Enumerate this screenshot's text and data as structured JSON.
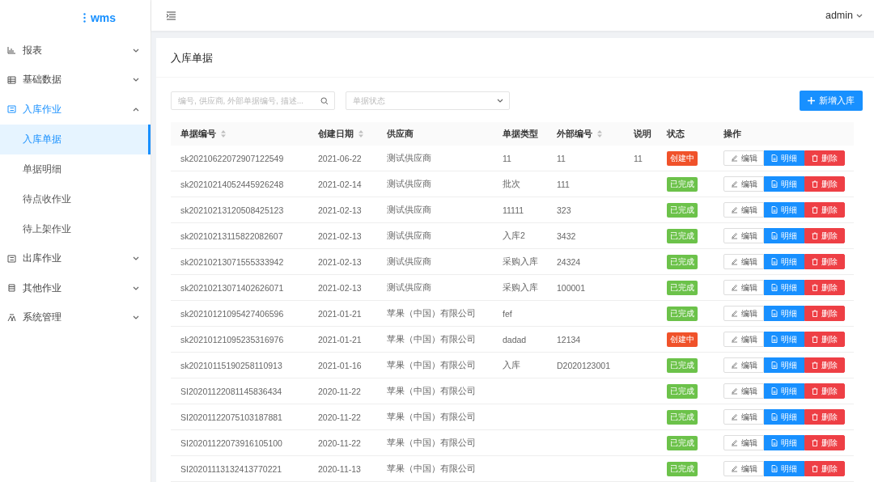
{
  "logo": {
    "text": "wms"
  },
  "header": {
    "user": "admin"
  },
  "sidebar": {
    "items": [
      {
        "label": "报表",
        "expanded": false
      },
      {
        "label": "基础数据",
        "expanded": false
      },
      {
        "label": "入库作业",
        "expanded": true,
        "children": [
          {
            "label": "入库单据",
            "selected": true
          },
          {
            "label": "单据明细",
            "selected": false
          },
          {
            "label": "待点收作业",
            "selected": false
          },
          {
            "label": "待上架作业",
            "selected": false
          }
        ]
      },
      {
        "label": "出库作业",
        "expanded": false
      },
      {
        "label": "其他作业",
        "expanded": false
      },
      {
        "label": "系统管理",
        "expanded": false
      }
    ]
  },
  "page": {
    "title": "入库单据",
    "search": {
      "placeholder": "编号, 供应商, 外部单据编号, 描述..."
    },
    "status_filter": {
      "placeholder": "单据状态"
    },
    "add_button": "新增入库"
  },
  "table": {
    "columns": [
      {
        "label": "单据编号",
        "sortable": true
      },
      {
        "label": "创建日期",
        "sortable": true
      },
      {
        "label": "供应商",
        "sortable": false
      },
      {
        "label": "单据类型",
        "sortable": false
      },
      {
        "label": "外部编号",
        "sortable": true
      },
      {
        "label": "说明",
        "sortable": false
      },
      {
        "label": "状态",
        "sortable": false
      },
      {
        "label": "操作",
        "sortable": false
      }
    ],
    "rows": [
      {
        "id": "sk20210622072907122549",
        "date": "2021-06-22",
        "supplier": "测试供应商",
        "type": "11",
        "external": "11",
        "note": "11",
        "status": {
          "label": "创建中",
          "kind": "creating"
        },
        "actions": [
          "编辑",
          "明细",
          "删除"
        ]
      },
      {
        "id": "sk20210214052445926248",
        "date": "2021-02-14",
        "supplier": "测试供应商",
        "type": "批次",
        "external": "111",
        "status": {
          "label": "已完成",
          "kind": "done"
        },
        "actions": [
          "编辑",
          "明细",
          "删除"
        ]
      },
      {
        "id": "sk20210213120508425123",
        "date": "2021-02-13",
        "supplier": "测试供应商",
        "type": "11111",
        "external": "323",
        "status": {
          "label": "已完成",
          "kind": "done"
        },
        "actions": [
          "编辑",
          "明细",
          "删除"
        ]
      },
      {
        "id": "sk20210213115822082607",
        "date": "2021-02-13",
        "supplier": "测试供应商",
        "type": "入库2",
        "external": "3432",
        "status": {
          "label": "已完成",
          "kind": "done"
        },
        "actions": [
          "编辑",
          "明细",
          "删除"
        ]
      },
      {
        "id": "sk20210213071555333942",
        "date": "2021-02-13",
        "supplier": "测试供应商",
        "type": "采购入库",
        "external": "24324",
        "status": {
          "label": "已完成",
          "kind": "done"
        },
        "actions": [
          "编辑",
          "明细",
          "删除"
        ]
      },
      {
        "id": "sk20210213071402626071",
        "date": "2021-02-13",
        "supplier": "测试供应商",
        "type": "采购入库",
        "external": "100001",
        "status": {
          "label": "已完成",
          "kind": "done"
        },
        "actions": [
          "编辑",
          "明细",
          "删除"
        ]
      },
      {
        "id": "sk20210121095427406596",
        "date": "2021-01-21",
        "supplier": "苹果（中国）有限公司",
        "type": "fef",
        "status": {
          "label": "已完成",
          "kind": "done"
        },
        "actions": [
          "编辑",
          "明细",
          "删除"
        ]
      },
      {
        "id": "sk20210121095235316976",
        "date": "2021-01-21",
        "supplier": "苹果（中国）有限公司",
        "type": "dadad",
        "external": "12134",
        "status": {
          "label": "创建中",
          "kind": "creating"
        },
        "actions": [
          "编辑",
          "明细",
          "删除"
        ]
      },
      {
        "id": "sk20210115190258110913",
        "date": "2021-01-16",
        "supplier": "苹果（中国）有限公司",
        "type": "入库",
        "external": "D2020123001",
        "status": {
          "label": "已完成",
          "kind": "done"
        },
        "actions": [
          "编辑",
          "明细",
          "删除"
        ]
      },
      {
        "id": "SI20201122081145836434",
        "date": "2020-11-22",
        "supplier": "苹果（中国）有限公司",
        "status": {
          "label": "已完成",
          "kind": "done"
        },
        "actions": [
          "编辑",
          "明细",
          "删除"
        ]
      },
      {
        "id": "SI20201122075103187881",
        "date": "2020-11-22",
        "supplier": "苹果（中国）有限公司",
        "status": {
          "label": "已完成",
          "kind": "done"
        },
        "actions": [
          "编辑",
          "明细",
          "删除"
        ]
      },
      {
        "id": "SI20201122073916105100",
        "date": "2020-11-22",
        "supplier": "苹果（中国）有限公司",
        "status": {
          "label": "已完成",
          "kind": "done"
        },
        "actions": [
          "编辑",
          "明细",
          "删除"
        ]
      },
      {
        "id": "SI20201113132413770221",
        "date": "2020-11-13",
        "supplier": "苹果（中国）有限公司",
        "status": {
          "label": "已完成",
          "kind": "done"
        },
        "actions": [
          "编辑",
          "明细",
          "删除"
        ]
      }
    ]
  }
}
